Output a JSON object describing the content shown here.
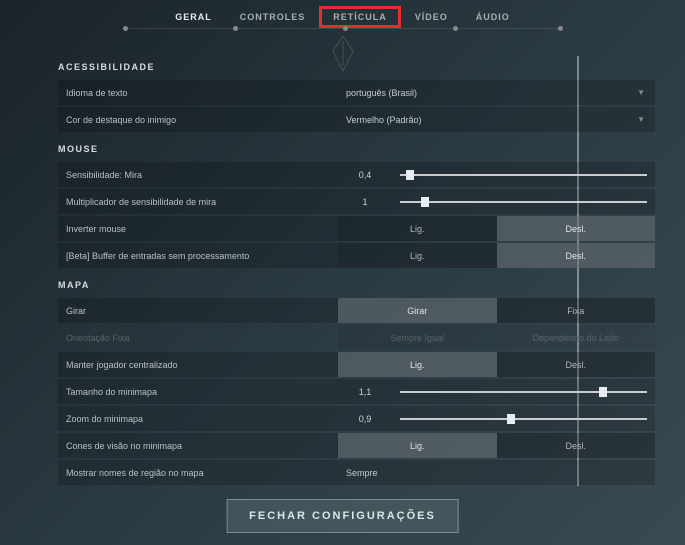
{
  "tabs": {
    "geral": "GERAL",
    "controles": "CONTROLES",
    "reticula": "RETÍCULA",
    "video": "VÍDEO",
    "audio": "ÁUDIO"
  },
  "sections": {
    "accessibility": "ACESSIBILIDADE",
    "mouse": "MOUSE",
    "map": "MAPA"
  },
  "rows": {
    "lang_label": "Idioma de texto",
    "lang_value": "português (Brasil)",
    "enemy_label": "Cor de destaque do inimigo",
    "enemy_value": "Vermelho (Padrão)",
    "sens_label": "Sensibilidade: Mira",
    "sens_value": "0,4",
    "mult_label": "Multiplicador de sensibilidade de mira",
    "mult_value": "1",
    "invert_label": "Inverter mouse",
    "rawbuf_label": "[Beta] Buffer de entradas sem processamento",
    "rotate_label": "Girar",
    "rotate_opt1": "Girar",
    "rotate_opt2": "Fixa",
    "fixedorient_label": "Orientação Fixa",
    "fixedorient_opt1": "Sempre Igual",
    "fixedorient_opt2": "Dependendo do Lado",
    "keepcenter_label": "Manter jogador centralizado",
    "mapsize_label": "Tamanho do minimapa",
    "mapsize_value": "1,1",
    "mapzoom_label": "Zoom do minimapa",
    "mapzoom_value": "0,9",
    "viscones_label": "Cones de visão no minimapa",
    "regnames_label": "Mostrar nomes de região no mapa",
    "regnames_value": "Sempre"
  },
  "common": {
    "on": "Lig.",
    "off": "Desl."
  },
  "close_button": "FECHAR CONFIGURAÇÕES"
}
